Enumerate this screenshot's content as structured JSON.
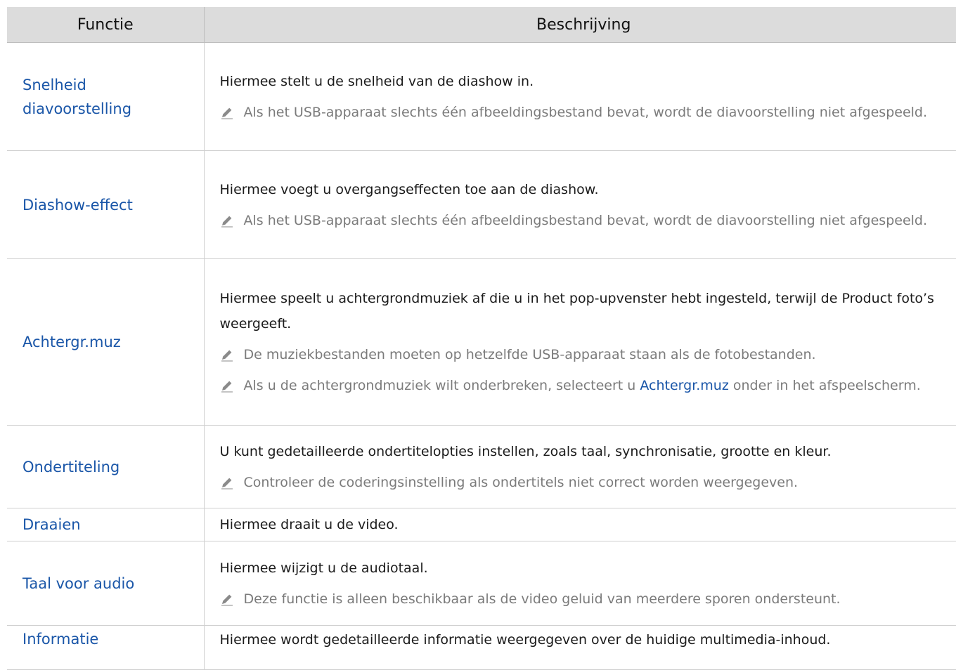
{
  "table": {
    "headers": {
      "function": "Functie",
      "description": "Beschrijving"
    },
    "rows": [
      {
        "function": "Snelheid diavoorstelling",
        "description": "Hiermee stelt u de snelheid van de diashow in.",
        "notes": [
          "Als het USB-apparaat slechts één afbeeldingsbestand bevat, wordt de diavoorstelling niet afgespeeld."
        ]
      },
      {
        "function": "Diashow-effect",
        "description": "Hiermee voegt u overgangseffecten toe aan de diashow.",
        "notes": [
          "Als het USB-apparaat slechts één afbeeldingsbestand bevat, wordt de diavoorstelling niet afgespeeld."
        ]
      },
      {
        "function": "Achtergr.muz",
        "description": "Hiermee speelt u achtergrondmuziek af die u in het pop-upvenster hebt ingesteld, terwijl de Product foto’s weergeeft.",
        "notes": [
          "De muziekbestanden moeten op hetzelfde USB-apparaat staan als de fotobestanden."
        ],
        "note_with_ref": {
          "before": "Als u de achtergrondmuziek wilt onderbreken, selecteert u ",
          "ref": "Achtergr.muz",
          "after": " onder in het afspeelscherm."
        }
      },
      {
        "function": "Ondertiteling",
        "description": "U kunt gedetailleerde ondertitelopties instellen, zoals taal, synchronisatie, grootte en kleur.",
        "notes": [
          "Controleer de coderingsinstelling als ondertitels niet correct worden weergegeven."
        ]
      },
      {
        "function": "Draaien",
        "description": "Hiermee draait u de video.",
        "notes": []
      },
      {
        "function": "Taal voor audio",
        "description": "Hiermee wijzigt u de audiotaal.",
        "notes": [
          "Deze functie is alleen beschikbaar als de video geluid van meerdere sporen ondersteunt."
        ]
      },
      {
        "function": "Informatie",
        "description": "Hiermee wordt gedetailleerde informatie weergegeven over de huidige multimedia-inhoud.",
        "notes": []
      }
    ]
  },
  "icons": {
    "note_icon": "pencil-icon",
    "note_icon_color": "#8a8a8a",
    "link_color": "#1a56a8",
    "header_bg": "#dcdcdc"
  }
}
